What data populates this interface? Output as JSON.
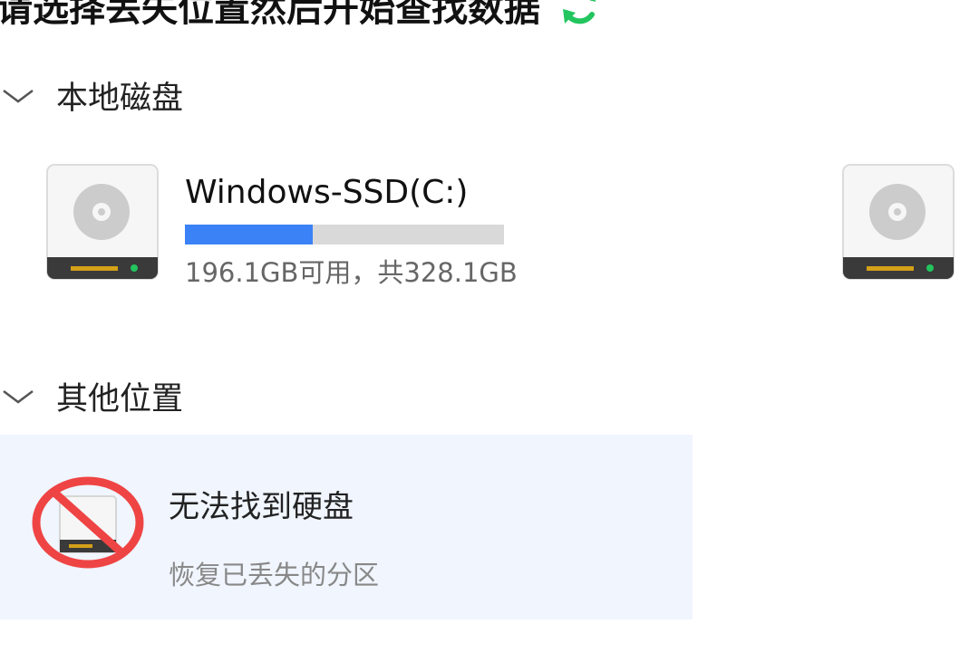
{
  "header": {
    "title": "请选择丢失位置然后开始查找数据",
    "refresh_icon": "refresh-icon"
  },
  "colors": {
    "accent_blue": "#3b82f6",
    "refresh_green": "#22c55e",
    "forbidden_red": "#ef4444",
    "card_bg": "#f0f5fe"
  },
  "sections": {
    "local": {
      "label": "本地磁盘",
      "icon": "chevron-down-icon"
    },
    "other": {
      "label": "其他位置",
      "icon": "chevron-down-icon"
    }
  },
  "drives": [
    {
      "name": "Windows-SSD(C:)",
      "space_text": "196.1GB可用，共328.1GB",
      "used_fraction": 0.4,
      "icon": "hard-drive-icon"
    },
    {
      "icon": "hard-drive-icon"
    }
  ],
  "lost_partition": {
    "title": "无法找到硬盘",
    "subtitle": "恢复已丢失的分区",
    "icon": "no-drive-icon"
  }
}
